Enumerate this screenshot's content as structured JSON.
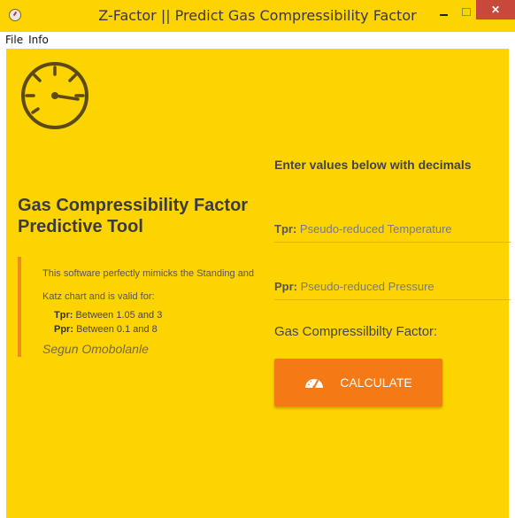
{
  "window": {
    "title": "Z-Factor || Predict Gas Compressibility Factor",
    "close_glyph": "✕"
  },
  "menu": [
    {
      "label": "File"
    },
    {
      "label": "Info"
    }
  ],
  "hero": {
    "icon": "speedometer-icon",
    "title": "Gas Compressibility Factor Predictive Tool"
  },
  "info": {
    "description": "This software perfectly mimicks the Standing and Katz chart and is valid for:",
    "tpr_label": "Tpr:",
    "tpr_range": "Between 1.05 and 3",
    "ppr_label": "Ppr:",
    "ppr_range": "Between 0.1 and 8",
    "author": "Segun Omobolanle"
  },
  "form": {
    "heading": "Enter values below with decimals",
    "tpr_label": "Tpr:",
    "tpr_placeholder": "Pseudo-reduced Temperature",
    "tpr_value": "",
    "ppr_label": "Ppr:",
    "ppr_placeholder": "Pseudo-reduced Pressure",
    "ppr_value": "",
    "result_label": "Gas Compressilbilty Factor:",
    "calculate_label": "CALCULATE"
  },
  "colors": {
    "background": "#fdd400",
    "accent": "#f57a16",
    "info_bar": "#f08c1f"
  }
}
